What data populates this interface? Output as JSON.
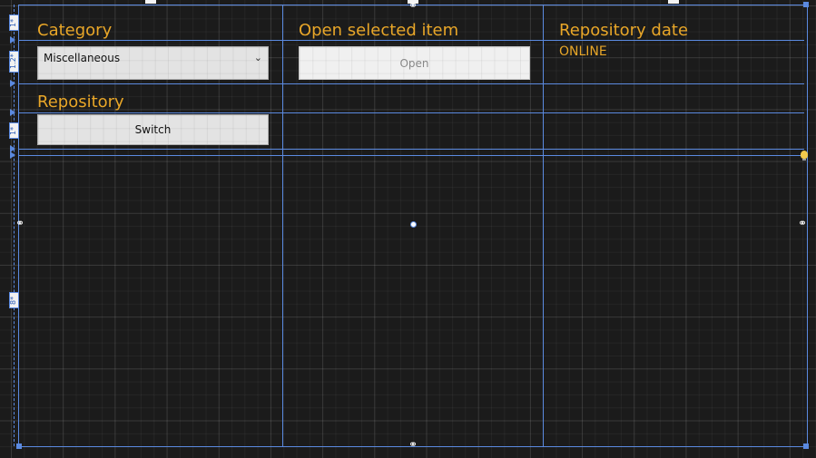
{
  "labels": {
    "category": "Category",
    "open_selected_item": "Open selected item",
    "repository_date": "Repository date",
    "repository": "Repository"
  },
  "category_combo": {
    "selected": "Miscellaneous",
    "chevron": "chevron-down-icon"
  },
  "buttons": {
    "open": "Open",
    "switch": "Switch"
  },
  "repository_date_value": "ONLINE",
  "row_rulers": [
    "1*",
    "1.2*",
    "1*",
    "8*"
  ],
  "colors": {
    "label_text": "#e8a628",
    "grid_lines": "#5b8ae0",
    "canvas_bg": "#1b1b1b",
    "control_bg": "#e3e3e3"
  },
  "icons": [
    "chevron-down-icon",
    "anchor-icon",
    "lightbulb-icon"
  ]
}
